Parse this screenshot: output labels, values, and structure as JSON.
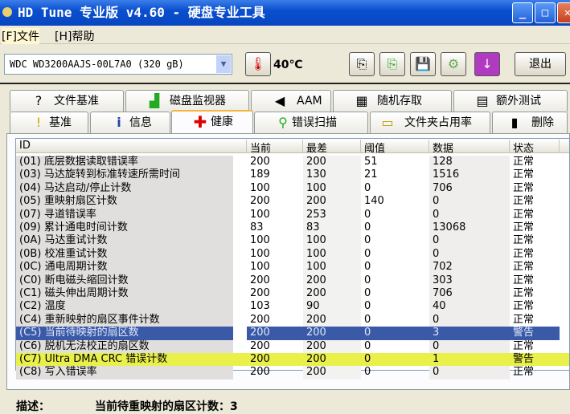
{
  "window": {
    "title": "HD Tune 专业版 v4.60 - 硬盘专业工具",
    "minimize": "_",
    "maximize": "□",
    "close": "✕"
  },
  "menu": [
    "[F]文件",
    "[H]帮助"
  ],
  "toolbar": {
    "drive": "WDC WD3200AAJS-00L7A0 (320 gB)",
    "temperature": "40℃",
    "exit": "退出"
  },
  "tabs_top": [
    {
      "label": "文件基准",
      "icon": "?"
    },
    {
      "label": "磁盘监视器",
      "icon": "▟"
    },
    {
      "label": "AAM",
      "icon": "◀"
    },
    {
      "label": "随机存取",
      "icon": "▦"
    },
    {
      "label": "额外测试",
      "icon": "▤"
    }
  ],
  "tabs_bottom": [
    {
      "label": "基准",
      "icon": "!"
    },
    {
      "label": "信息",
      "icon": "i"
    },
    {
      "label": "健康",
      "icon": "✚"
    },
    {
      "label": "错误扫描",
      "icon": "⚲"
    },
    {
      "label": "文件夹占用率",
      "icon": "▭"
    },
    {
      "label": "删除",
      "icon": "▮"
    }
  ],
  "table": {
    "headers": [
      "ID",
      "当前",
      "最差",
      "阈值",
      "数据",
      "状态"
    ],
    "rows": [
      [
        "(01) 底层数据读取错误率",
        "200",
        "200",
        "51",
        "128",
        "正常"
      ],
      [
        "(03) 马达旋转到标准转速所需时间",
        "189",
        "130",
        "21",
        "1516",
        "正常"
      ],
      [
        "(04) 马达启动/停止计数",
        "100",
        "100",
        "0",
        "706",
        "正常"
      ],
      [
        "(05) 重映射扇区计数",
        "200",
        "200",
        "140",
        "0",
        "正常"
      ],
      [
        "(07) 寻道错误率",
        "100",
        "253",
        "0",
        "0",
        "正常"
      ],
      [
        "(09) 累计通电时间计数",
        "83",
        "83",
        "0",
        "13068",
        "正常"
      ],
      [
        "(0A) 马达重试计数",
        "100",
        "100",
        "0",
        "0",
        "正常"
      ],
      [
        "(0B) 校准重试计数",
        "100",
        "100",
        "0",
        "0",
        "正常"
      ],
      [
        "(0C) 通电周期计数",
        "100",
        "100",
        "0",
        "702",
        "正常"
      ],
      [
        "(C0) 断电磁头缩回计数",
        "200",
        "200",
        "0",
        "303",
        "正常"
      ],
      [
        "(C1) 磁头伸出周期计数",
        "200",
        "200",
        "0",
        "706",
        "正常"
      ],
      [
        "(C2) 温度",
        "103",
        "90",
        "0",
        "40",
        "正常"
      ],
      [
        "(C4) 重新映射的扇区事件计数",
        "200",
        "200",
        "0",
        "0",
        "正常"
      ],
      [
        "(C5) 当前待映射的扇区数",
        "200",
        "200",
        "0",
        "3",
        "警告"
      ],
      [
        "(C6) 脱机无法校正的扇区数",
        "200",
        "200",
        "0",
        "0",
        "正常"
      ],
      [
        "(C7) Ultra DMA CRC 错误计数",
        "200",
        "200",
        "0",
        "1",
        "警告"
      ],
      [
        "(C8) 写入错误率",
        "200",
        "200",
        "0",
        "0",
        "正常"
      ]
    ]
  },
  "description": {
    "label": "描述：",
    "text": "当前待重映射的扇区计数：3"
  }
}
